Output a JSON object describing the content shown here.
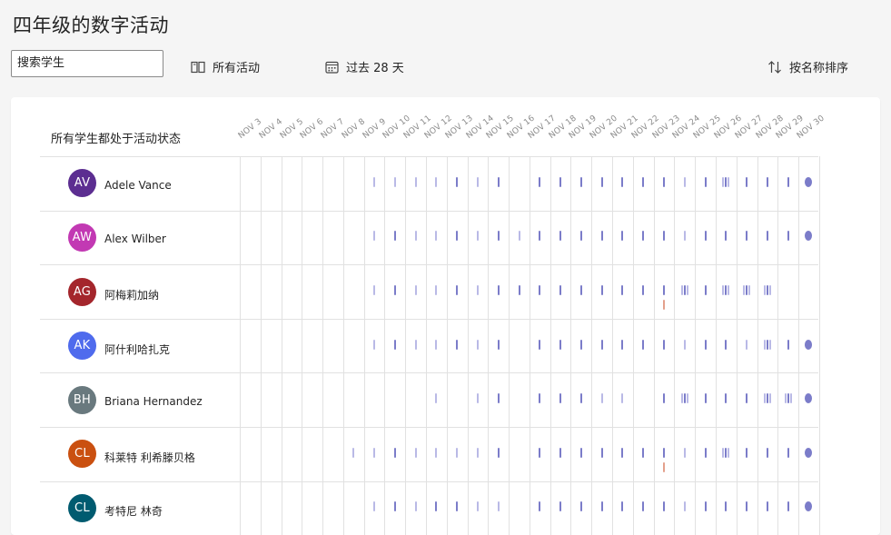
{
  "page_title": "四年级的数字活动",
  "search": {
    "value": "搜索学生"
  },
  "toolbar": {
    "activity_filter": "所有活动",
    "date_range": "过去 28 天",
    "sort": "按名称排序"
  },
  "grid": {
    "status_label": "所有学生都处于活动状态",
    "dates": [
      "NOV 3",
      "NOV 4",
      "NOV 5",
      "NOV 6",
      "NOV 7",
      "NOV 8",
      "NOV 9",
      "NOV 10",
      "NOV 11",
      "NOV 12",
      "NOV 13",
      "NOV 14",
      "NOV 15",
      "NOV 16",
      "NOV 17",
      "NOV 18",
      "NOV 19",
      "NOV 20",
      "NOV 21",
      "NOV 22",
      "NOV 23",
      "NOV 24",
      "NOV 25",
      "NOV 26",
      "NOV 27",
      "NOV 28",
      "NOV 29",
      "NOV 30"
    ]
  },
  "colors": {
    "activity_mark": "#7b7cc9",
    "activity_mark_light": "#b9b9e6",
    "alert_mark": "#e4a08c",
    "grid_line": "#e1e1e1"
  },
  "students": [
    {
      "initials": "AV",
      "name": "Adele Vance",
      "avatar_color": "#5c2e91",
      "activity": [
        [
          6,
          "light"
        ],
        [
          7,
          "light"
        ],
        [
          8,
          "light"
        ],
        [
          9,
          "light"
        ],
        [
          10,
          "dark"
        ],
        [
          11,
          "light"
        ],
        [
          12,
          "dark"
        ],
        [
          14,
          "dark"
        ],
        [
          15,
          "dark"
        ],
        [
          16,
          "dark"
        ],
        [
          17,
          "dark"
        ],
        [
          18,
          "dark"
        ],
        [
          19,
          "dark"
        ],
        [
          20,
          "dark"
        ],
        [
          21,
          "light"
        ],
        [
          22,
          "dark"
        ],
        [
          23,
          "multi"
        ],
        [
          24,
          "dark"
        ],
        [
          25,
          "dark"
        ],
        [
          26,
          "dark"
        ],
        [
          27,
          "dot"
        ]
      ],
      "alerts": []
    },
    {
      "initials": "AW",
      "name": "Alex Wilber",
      "avatar_color": "#c239b3",
      "activity": [
        [
          6,
          "light"
        ],
        [
          7,
          "dark"
        ],
        [
          8,
          "light"
        ],
        [
          9,
          "light"
        ],
        [
          10,
          "dark"
        ],
        [
          11,
          "light"
        ],
        [
          12,
          "dark"
        ],
        [
          13,
          "light"
        ],
        [
          14,
          "dark"
        ],
        [
          15,
          "dark"
        ],
        [
          16,
          "dark"
        ],
        [
          17,
          "dark"
        ],
        [
          18,
          "dark"
        ],
        [
          19,
          "dark"
        ],
        [
          20,
          "dark"
        ],
        [
          21,
          "light"
        ],
        [
          22,
          "dark"
        ],
        [
          23,
          "dark"
        ],
        [
          24,
          "dark"
        ],
        [
          25,
          "dark"
        ],
        [
          26,
          "dark"
        ],
        [
          27,
          "dot"
        ]
      ],
      "alerts": []
    },
    {
      "initials": "AG",
      "name": "阿梅莉加纳",
      "avatar_color": "#a4262c",
      "activity": [
        [
          6,
          "light"
        ],
        [
          7,
          "dark"
        ],
        [
          8,
          "light"
        ],
        [
          9,
          "light"
        ],
        [
          10,
          "dark"
        ],
        [
          11,
          "light"
        ],
        [
          12,
          "dark"
        ],
        [
          13,
          "dark"
        ],
        [
          14,
          "dark"
        ],
        [
          15,
          "dark"
        ],
        [
          16,
          "dark"
        ],
        [
          17,
          "dark"
        ],
        [
          18,
          "dark"
        ],
        [
          19,
          "dark"
        ],
        [
          20,
          "dark"
        ],
        [
          21,
          "multi"
        ],
        [
          22,
          "dark"
        ],
        [
          23,
          "multi"
        ],
        [
          24,
          "multi"
        ],
        [
          25,
          "multi"
        ]
      ],
      "alerts": [
        20
      ]
    },
    {
      "initials": "AK",
      "name": "阿什利哈扎克",
      "avatar_color": "#4f6bed",
      "activity": [
        [
          6,
          "light"
        ],
        [
          7,
          "dark"
        ],
        [
          8,
          "light"
        ],
        [
          9,
          "light"
        ],
        [
          10,
          "dark"
        ],
        [
          11,
          "light"
        ],
        [
          12,
          "dark"
        ],
        [
          14,
          "dark"
        ],
        [
          15,
          "dark"
        ],
        [
          16,
          "dark"
        ],
        [
          17,
          "dark"
        ],
        [
          18,
          "dark"
        ],
        [
          19,
          "dark"
        ],
        [
          20,
          "dark"
        ],
        [
          21,
          "light"
        ],
        [
          22,
          "dark"
        ],
        [
          23,
          "dark"
        ],
        [
          24,
          "light"
        ],
        [
          25,
          "multi"
        ],
        [
          26,
          "dark"
        ],
        [
          27,
          "dot"
        ]
      ],
      "alerts": []
    },
    {
      "initials": "BH",
      "name": "Briana Hernandez",
      "avatar_color": "#69797e",
      "activity": [
        [
          9,
          "light"
        ],
        [
          11,
          "light"
        ],
        [
          12,
          "dark"
        ],
        [
          14,
          "dark"
        ],
        [
          15,
          "dark"
        ],
        [
          16,
          "dark"
        ],
        [
          17,
          "light"
        ],
        [
          18,
          "light"
        ],
        [
          20,
          "dark"
        ],
        [
          21,
          "multi"
        ],
        [
          22,
          "dark"
        ],
        [
          23,
          "dark"
        ],
        [
          24,
          "dark"
        ],
        [
          25,
          "multi"
        ],
        [
          26,
          "multi"
        ],
        [
          27,
          "dot"
        ]
      ],
      "alerts": []
    },
    {
      "initials": "CL",
      "name": "科莱特 利希滕贝格",
      "avatar_color": "#ca5010",
      "activity": [
        [
          5,
          "light"
        ],
        [
          6,
          "light"
        ],
        [
          7,
          "dark"
        ],
        [
          8,
          "light"
        ],
        [
          9,
          "light"
        ],
        [
          10,
          "light"
        ],
        [
          11,
          "light"
        ],
        [
          12,
          "dark"
        ],
        [
          14,
          "dark"
        ],
        [
          15,
          "dark"
        ],
        [
          16,
          "dark"
        ],
        [
          17,
          "dark"
        ],
        [
          18,
          "dark"
        ],
        [
          19,
          "dark"
        ],
        [
          20,
          "dark"
        ],
        [
          21,
          "light"
        ],
        [
          22,
          "dark"
        ],
        [
          23,
          "multi"
        ],
        [
          24,
          "dark"
        ],
        [
          25,
          "dark"
        ],
        [
          26,
          "dark"
        ],
        [
          27,
          "dot"
        ]
      ],
      "alerts": [
        20
      ]
    },
    {
      "initials": "CL",
      "name": "考特尼 林奇",
      "avatar_color": "#005b70",
      "activity": [
        [
          6,
          "light"
        ],
        [
          7,
          "dark"
        ],
        [
          8,
          "light"
        ],
        [
          9,
          "dark"
        ],
        [
          10,
          "dark"
        ],
        [
          11,
          "light"
        ],
        [
          12,
          "light"
        ],
        [
          14,
          "dark"
        ],
        [
          15,
          "dark"
        ],
        [
          16,
          "dark"
        ],
        [
          17,
          "dark"
        ],
        [
          18,
          "dark"
        ],
        [
          19,
          "dark"
        ],
        [
          20,
          "dark"
        ],
        [
          21,
          "light"
        ],
        [
          22,
          "dark"
        ],
        [
          23,
          "dark"
        ],
        [
          24,
          "dark"
        ],
        [
          25,
          "dark"
        ],
        [
          26,
          "dark"
        ],
        [
          27,
          "dot"
        ]
      ],
      "alerts": []
    }
  ]
}
